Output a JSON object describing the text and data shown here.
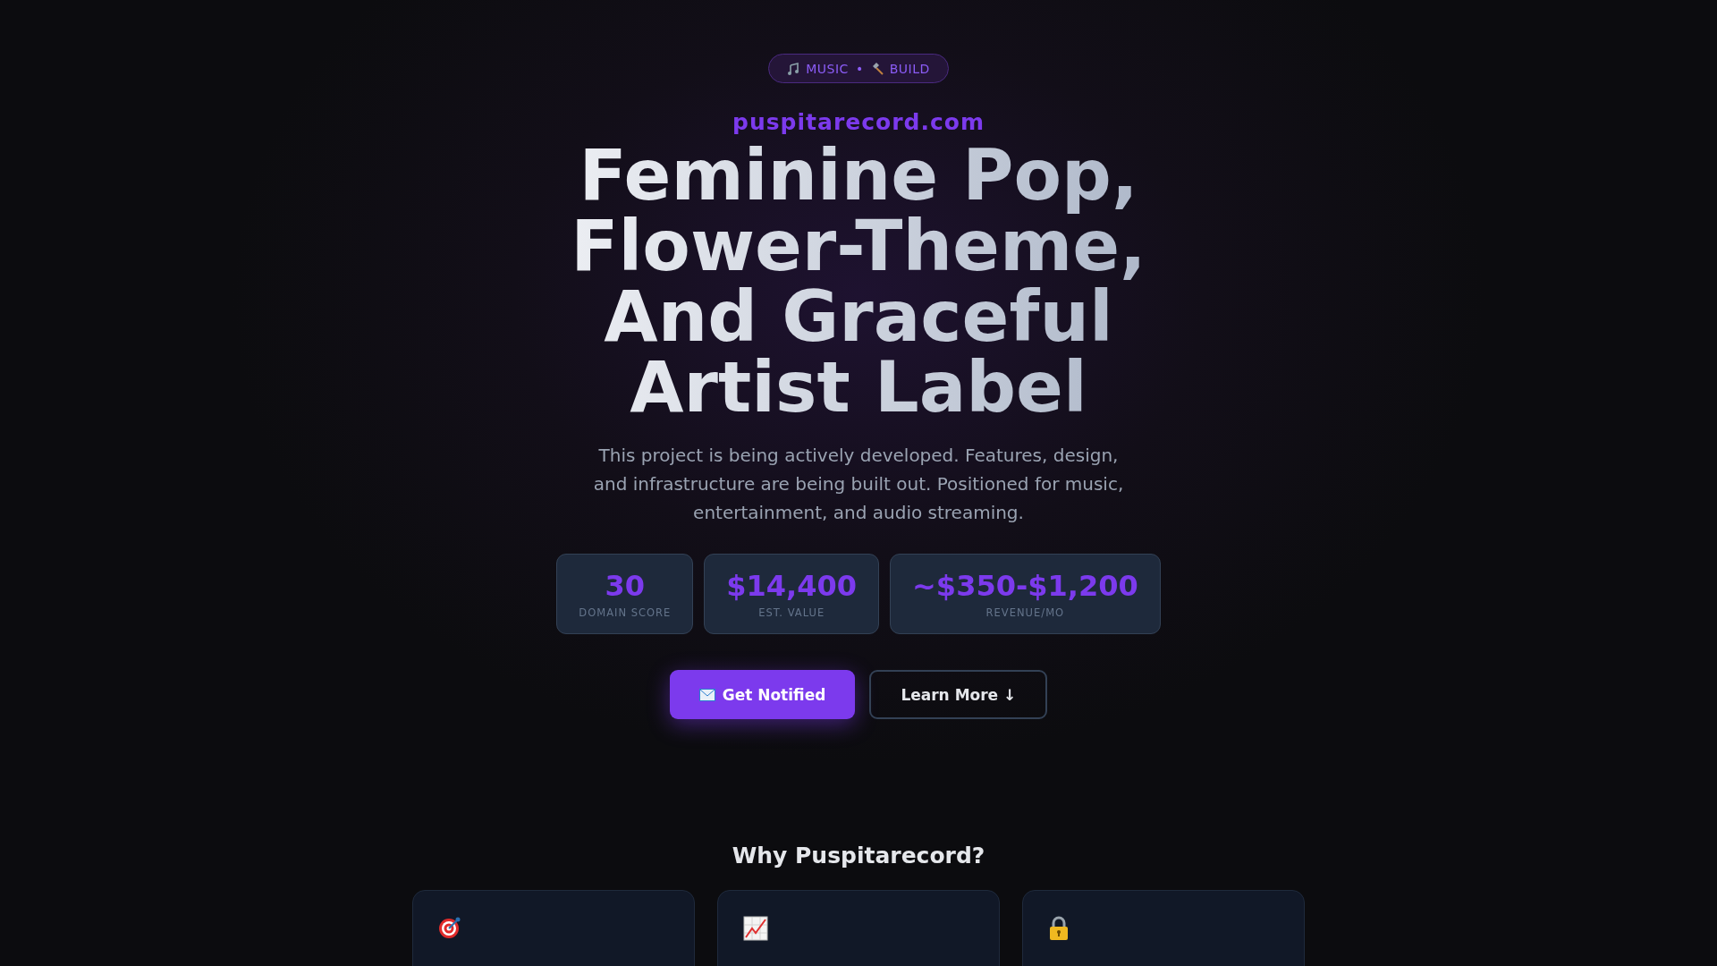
{
  "badge": {
    "items": [
      {
        "kind": "music",
        "label": "MUSIC"
      },
      {
        "kind": "build",
        "label": "BUILD"
      }
    ],
    "separator": "•"
  },
  "domain": "puspitarecord.com",
  "headline": "Feminine Pop, Flower-Theme, And Graceful Artist Label",
  "description": "This project is being actively developed. Features, design, and infrastructure are being built out. Positioned for music, entertainment, and audio streaming.",
  "stats": [
    {
      "value": "30",
      "label": "DOMAIN SCORE"
    },
    {
      "value": "$14,400",
      "label": "EST. VALUE"
    },
    {
      "value": "~$350-$1,200",
      "label": "REVENUE/MO"
    }
  ],
  "buttons": [
    {
      "kind": "primary",
      "label": "Get Notified"
    },
    {
      "kind": "secondary",
      "label": "Learn More ↓"
    }
  ],
  "features": {
    "title": "Why Puspitarecord?",
    "cards": [
      {
        "kind": "target"
      },
      {
        "kind": "chart"
      },
      {
        "kind": "lock"
      }
    ]
  }
}
